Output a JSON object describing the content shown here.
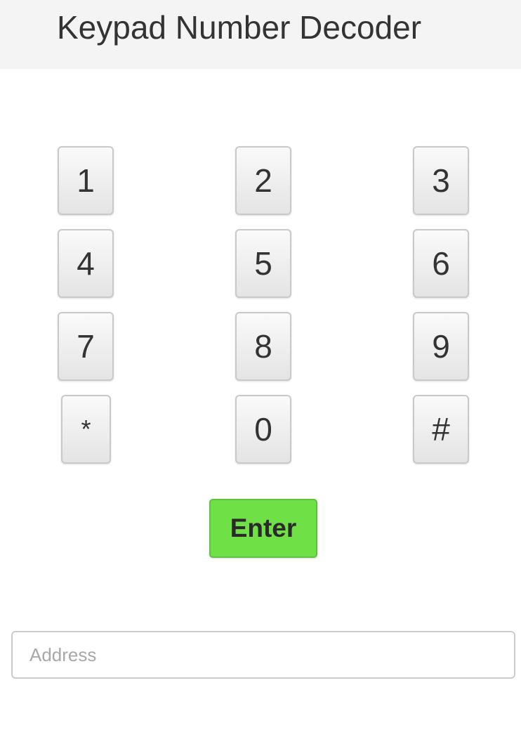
{
  "header": {
    "title": "Keypad Number Decoder"
  },
  "keypad": {
    "keys": [
      {
        "label": "1"
      },
      {
        "label": "2"
      },
      {
        "label": "3"
      },
      {
        "label": "4"
      },
      {
        "label": "5"
      },
      {
        "label": "6"
      },
      {
        "label": "7"
      },
      {
        "label": "8"
      },
      {
        "label": "9"
      },
      {
        "label": "*"
      },
      {
        "label": "0"
      },
      {
        "label": "#"
      }
    ]
  },
  "enter_button": {
    "label": "Enter",
    "color": "#6fe046"
  },
  "address_field": {
    "value": "",
    "placeholder": "Address"
  }
}
